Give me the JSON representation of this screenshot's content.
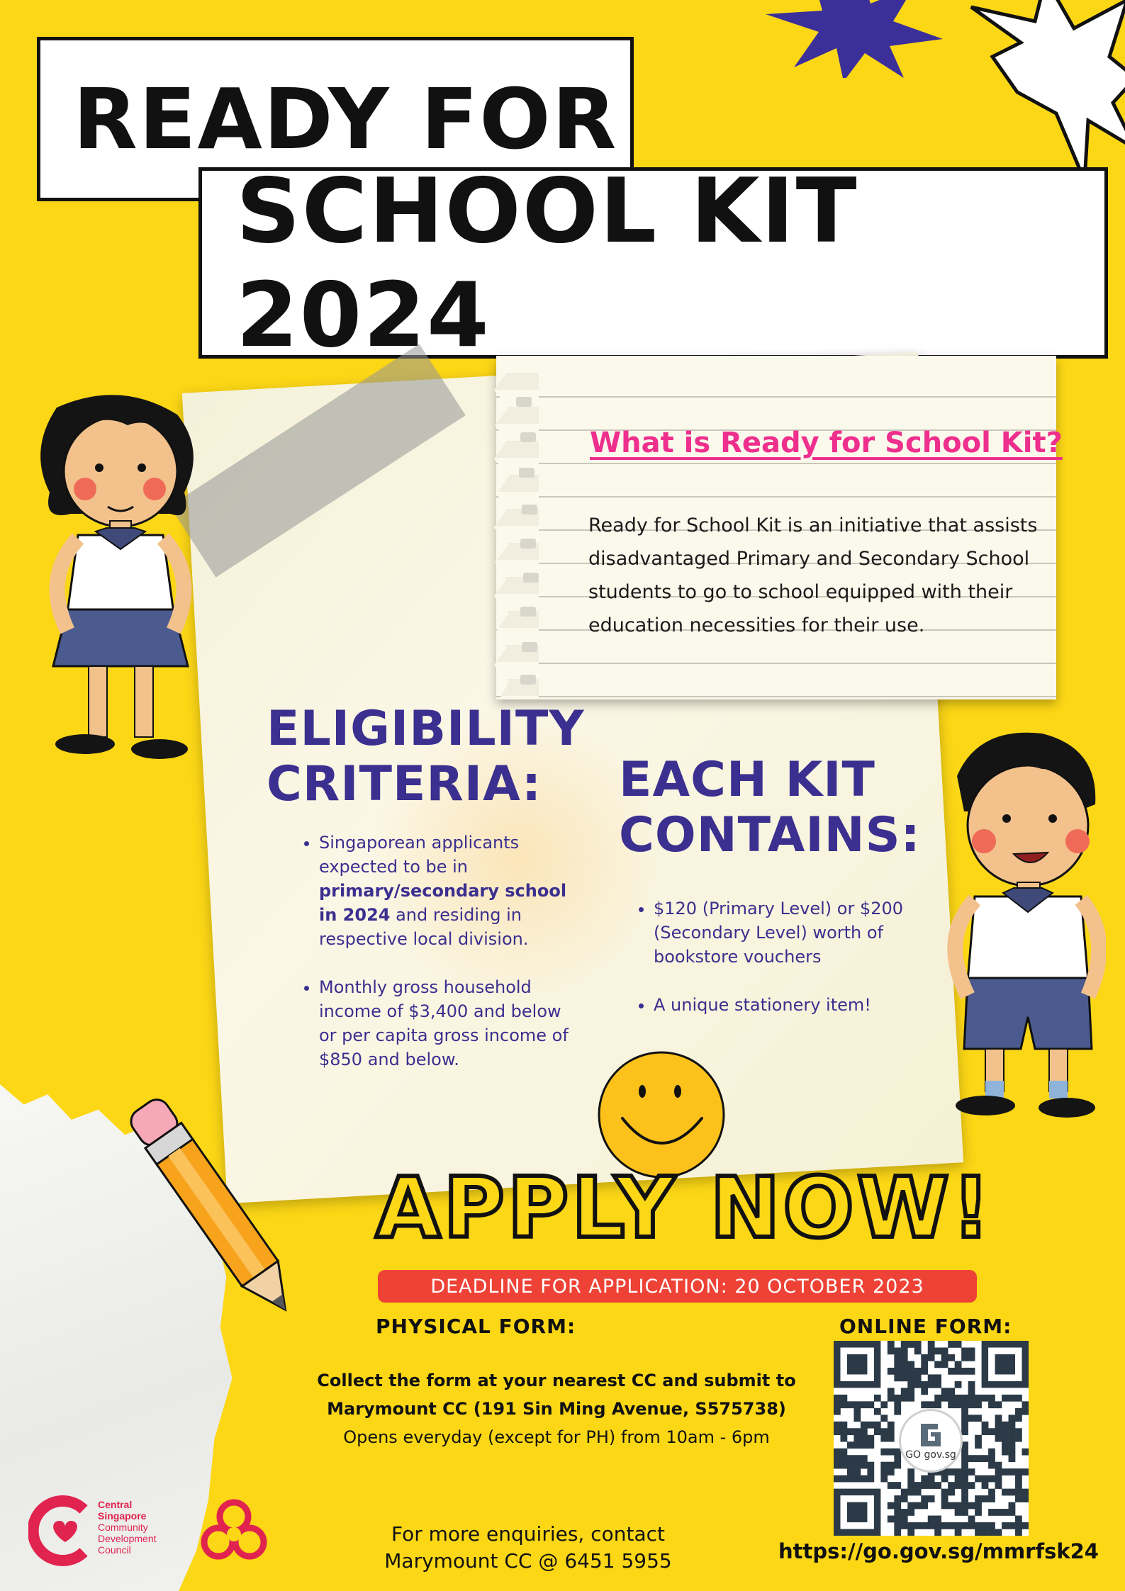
{
  "title": {
    "line1": "READY FOR",
    "line2": "SCHOOL KIT 2024"
  },
  "about": {
    "heading": "What is Ready for School Kit?",
    "body": "Ready for School Kit is an initiative that assists disadvantaged Primary and Secondary School students to go to school equipped with their education necessities for their use."
  },
  "eligibility": {
    "heading_line1": "ELIGIBILITY",
    "heading_line2": "CRITERIA:",
    "item1_pre": "Singaporean applicants expected to be in ",
    "item1_bold": "primary/secondary school in 2024",
    "item1_post": " and residing in respective local division.",
    "item2": "Monthly gross household income of $3,400 and below or per capita gross income of $850 and below."
  },
  "kit": {
    "heading_line1": "EACH KIT",
    "heading_line2": "CONTAINS:",
    "item1": "$120 (Primary Level) or $200 (Secondary Level) worth of bookstore vouchers",
    "item2": "A unique stationery item!"
  },
  "apply": {
    "headline": "APPLY NOW!",
    "deadline": "DEADLINE FOR APPLICATION: 20 OCTOBER 2023",
    "physical_label": "PHYSICAL FORM:",
    "online_label": "ONLINE FORM:",
    "collect_line1": "Collect the form at your nearest CC and submit to",
    "collect_line2": "Marymount CC (191 Sin Ming Avenue, S575738)",
    "collect_line3": "Opens everyday (except for PH) from 10am - 6pm",
    "enquiry_line1": "For more enquiries, contact",
    "enquiry_line2": "Marymount CC @ 6451 5955",
    "url": "https://go.gov.sg/mmrfsk24",
    "qr_logo_text": "GO gov.sg"
  },
  "logos": {
    "cdc_line1": "Central",
    "cdc_line2": "Singapore",
    "cdc_line3": "Community",
    "cdc_line4": "Development",
    "cdc_line5": "Council"
  },
  "colors": {
    "background": "#fcd716",
    "heading_purple": "#3b2f8f",
    "note_heading_pink": "#ee2f8d",
    "deadline_red": "#ee4236",
    "cdc_red": "#e0234f"
  },
  "icons": [
    "starburst-purple-icon",
    "starburst-white-icon",
    "smiley-face-icon",
    "pencil-icon",
    "qr-code-icon",
    "cdc-logo-icon",
    "pa-logo-icon"
  ]
}
